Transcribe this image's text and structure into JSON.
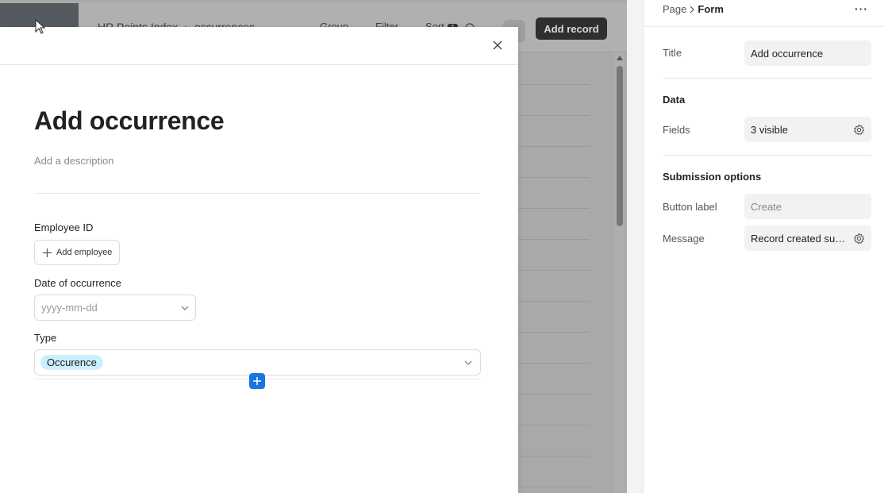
{
  "background_app": {
    "breadcrumb": [
      "HR Points Index",
      "occurrences"
    ],
    "toolbar_items": [
      "Group",
      "Filter",
      "Sort"
    ],
    "sort_count": "1",
    "add_record_label": "Add record"
  },
  "modal": {
    "title": "Add occurrence",
    "description_placeholder": "Add a description",
    "fields": {
      "employee": {
        "label": "Employee ID",
        "button_label": "Add employee"
      },
      "date": {
        "label": "Date of occurrence",
        "placeholder": "yyyy-mm-dd"
      },
      "type": {
        "label": "Type",
        "selected": "Occurence"
      }
    }
  },
  "panel": {
    "breadcrumb": {
      "parent": "Page",
      "current": "Form"
    },
    "title_label": "Title",
    "title_value": "Add occurrence",
    "data_section": "Data",
    "fields_label": "Fields",
    "fields_value": "3 visible",
    "submission_section": "Submission options",
    "button_label_label": "Button label",
    "button_label_value": "Create",
    "message_label": "Message",
    "message_value": "Record created successfully"
  },
  "colors": {
    "accent": "#1b74e4",
    "tag_bg": "#cdeefc",
    "dark_button": "#2f2f2f"
  }
}
